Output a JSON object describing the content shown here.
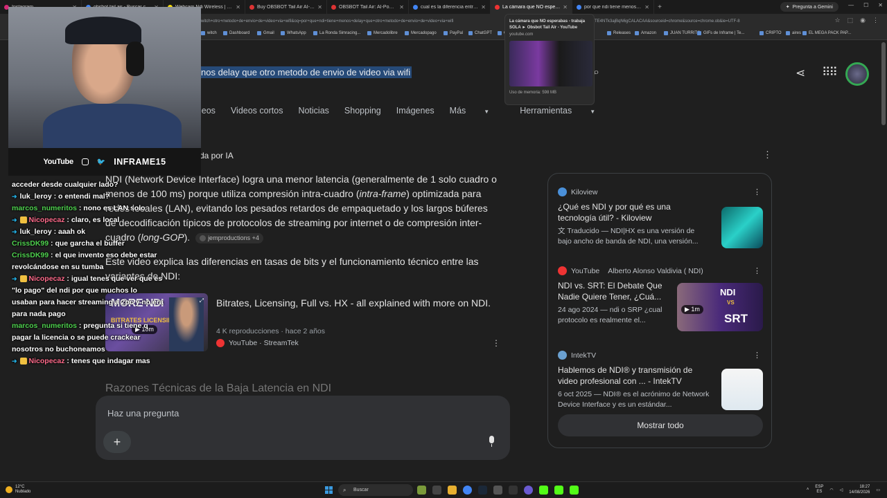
{
  "tabs": [
    {
      "label": "Instagram",
      "color": "#d62976"
    },
    {
      "label": "obsbot tail air - Buscar con Goo...",
      "color": "#4285f4"
    },
    {
      "label": "Webcam Ndi Wireless | Mercad...",
      "color": "#f5d90a"
    },
    {
      "label": "Buy OBSBOT Tail Air AI-Powere...",
      "color": "#d33"
    },
    {
      "label": "OBSBOT Tail Air: AI-Powered 4K...",
      "color": "#d33"
    },
    {
      "label": "cual es la diferencia entre la ca...",
      "color": "#4285f4"
    },
    {
      "label": "La cámara que NO esperabas...",
      "color": "#e33"
    },
    {
      "label": "por que ndi tiene menos delay...",
      "color": "#4285f4"
    }
  ],
  "browser": {
    "gemini_button": "Pregunta a Gemini",
    "url": "witch+otro+metodo+de+envio+de+video+via+wifi&oq=por+que+ndi+tiene+menos+delay+que+otro+metodo+de+envio+de+video+via+wifi",
    "url_tail": "TE4NTk3ajBqN6gCALACAA&sourceid=chrome&source=chrome.ob&ie=UTF-8"
  },
  "bookmarks": [
    "witch",
    "Dashboard",
    "Gmail",
    "WhatsApp",
    "La Ronda Simracing...",
    "Mercadolibre",
    "Mercadopago",
    "PayPal",
    "ChatGPT",
    "CS",
    "Releases",
    "Amazon",
    "JUAN TURRITO",
    "GIFs de Inframe | Te...",
    "CRIPTO",
    "aires",
    "EL MEGA PACK PAP..."
  ],
  "tooltip": {
    "title": "La cámara que NO esperabas - trabaja SOLA ► Obsbot Tail Air - YouTube",
    "domain": "youtube.com",
    "memory": "Uso de memoria: 598 MB"
  },
  "search": {
    "query": "nos delay que otro metodo de envio de video via wifi"
  },
  "nav": {
    "items": [
      "leos",
      "Videos cortos",
      "Noticias",
      "Shopping",
      "Imágenes",
      "Más"
    ],
    "tools": "Herramientas"
  },
  "ai": {
    "label": "da por IA",
    "p1_a": "NDI (Network Device Interface) logra una menor latencia (generalmente de 1 solo cuadro o menos de 100 ms) porque utiliza compresión intra-cuadro (",
    "p1_b": "intra-frame",
    "p1_c": ") optimizada para redes locales (LAN), evitando los pesados retardos de empaquetado y los largos búferes de decodificación típicos de protocolos de streaming por internet o de compresión inter-cuadro (",
    "p1_d": "long-GOP",
    "p1_e": ").",
    "chip": "jemproductions +4",
    "p2": "Este video explica las diferencias en tasas de bits y el funcionamiento técnico entre las variantes de NDI:",
    "heading": "Razones Técnicas de la Baja Latencia en NDI"
  },
  "video": {
    "thumb_title": "MORE NDI",
    "thumb_sub": "BITRATES LICENSING",
    "duration": "10m",
    "title": "Bitrates, Licensing, Full vs. HX - all explained with more on NDI.",
    "meta": "4 K reproducciones · hace 2 años",
    "source": "YouTube · StreamTek"
  },
  "ask": {
    "placeholder": "Haz una pregunta",
    "plus": "+"
  },
  "sources": [
    {
      "site": "Kiloview",
      "title": "¿Qué es NDI y por qué es una tecnología útil? - Kiloview",
      "snippet": "Traducido — NDI|HX es una versión de bajo ancho de banda de NDI, una versión...",
      "fav": "#4a90d9",
      "thumb": "#1fa3a3"
    },
    {
      "site": "YouTube",
      "author": "Alberto Alonso Valdivia ( NDI)",
      "title": "NDI vs. SRT: El Debate Que Nadie Quiere Tener, ¿Cuá...",
      "snippet": "24 ago 2024 — ndi o SRP ¿cual protocolo es realmente el...",
      "fav": "#e33",
      "thumb": "#5a3a8a",
      "duration": "1m",
      "thumb_t1": "NDI",
      "thumb_vs": "VS",
      "thumb_t2": "SRT"
    },
    {
      "site": "IntekTV",
      "title": "Hablemos de NDI® y transmisión de video profesional con ... - IntekTV",
      "snippet": "6 oct 2025 — NDI® es el acrónimo de Network Device Interface y es un estándar...",
      "fav": "#6aa0d0",
      "thumb": "#e8eef2"
    }
  ],
  "sources_more": "Mostrar todo",
  "stream": {
    "platform": "YouTube",
    "channel": "INFRAME15",
    "chat": [
      {
        "user": "",
        "text": "acceder desde cualquier lado?"
      },
      {
        "user": "luk_leroy",
        "text": ": o entendi mal?",
        "style": "plain"
      },
      {
        "user": "marcos_numeritos",
        "text": ": nono es LAN solo",
        "style": "green"
      },
      {
        "user": "Nicopecaz",
        "text": ": claro, es local",
        "style": "pink"
      },
      {
        "user": "luk_leroy",
        "text": ": aaah ok",
        "style": "plain"
      },
      {
        "user": "CrissDK99",
        "text": ": que garcha el buffer",
        "style": "green"
      },
      {
        "user": "CrissDK99",
        "text": ": el que invento eso debe estar revolcándose en su tumba",
        "style": "green"
      },
      {
        "user": "Nicopecaz",
        "text": ": igual tenes que ver que es \"lo pago\" del ndi por que muchos lo usaban para hacer streaming a 2pc y no era para nada pago",
        "style": "pink"
      },
      {
        "user": "marcos_numeritos",
        "text": ": pregunta si tiene q pagar la licencia o se puede crackear nosotros no buchoneamos",
        "style": "green"
      },
      {
        "user": "Nicopecaz",
        "text": ": tenes que indagar mas",
        "style": "pink"
      }
    ]
  },
  "taskbar": {
    "weather_temp": "12°C",
    "weather_desc": "Nublado",
    "search": "Buscar",
    "lang1": "ESP",
    "lang2": "ES",
    "time": "18:27",
    "date": "14/08/2026"
  }
}
